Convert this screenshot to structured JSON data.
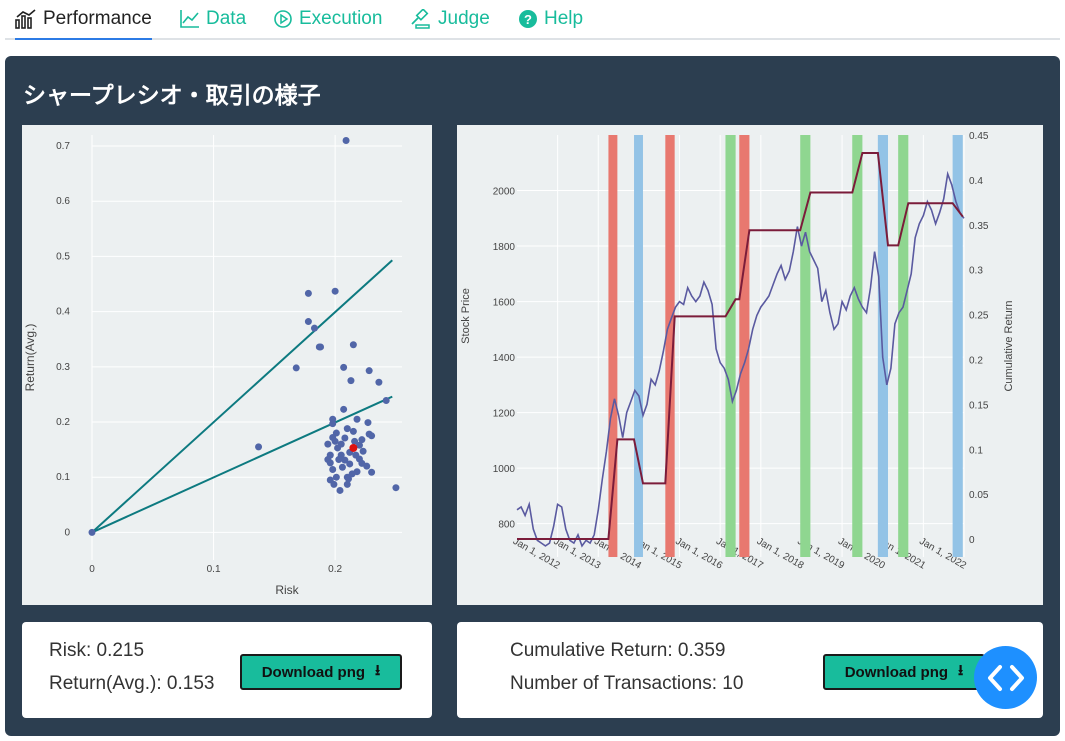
{
  "tabs": [
    {
      "label": "Performance",
      "icon": "chart-bar-icon"
    },
    {
      "label": "Data",
      "icon": "line-chart-icon"
    },
    {
      "label": "Execution",
      "icon": "play-circle-icon"
    },
    {
      "label": "Judge",
      "icon": "gavel-icon"
    },
    {
      "label": "Help",
      "icon": "question-circle-icon"
    }
  ],
  "panel": {
    "title": "シャープレシオ・取引の様子"
  },
  "left_card": {
    "risk_text": "Risk: 0.215",
    "return_text": "Return(Avg.): 0.153",
    "download_label": "Download png"
  },
  "right_card": {
    "cum_text": "Cumulative Return: 0.359",
    "ntx_text": "Number of Transactions: 10",
    "download_label": "Download png"
  },
  "colors": {
    "accent": "#18bc9c",
    "panel_bg": "#2c3e50",
    "plot_bg": "#ecf0f1",
    "scatter_point": "#5166a8",
    "highlight_point": "#dd1111",
    "line_teal": "#0d7a80",
    "cum_line": "#7b1c3a",
    "price_line": "#5a5aa0",
    "band_red": "#e8786f",
    "band_blue": "#93c3e6",
    "band_green": "#8fd690",
    "fab": "#1e90ff"
  },
  "chart_data": [
    {
      "type": "scatter",
      "xlabel": "Risk",
      "ylabel": "Return(Avg.)",
      "xlim": [
        0,
        0.255
      ],
      "ylim": [
        -0.05,
        0.72
      ],
      "xticks": [
        0,
        0.1,
        0.2
      ],
      "yticks": [
        0,
        0.1,
        0.2,
        0.3,
        0.4,
        0.5,
        0.6,
        0.7
      ],
      "x_tick_labels": [
        "0",
        "0.1",
        "0.2"
      ],
      "y_tick_labels": [
        "0",
        "0.1",
        "0.2",
        "0.3",
        "0.4",
        "0.5",
        "0.6",
        "0.7"
      ],
      "grid": true,
      "lines": [
        {
          "x": [
            0,
            0.247
          ],
          "y": [
            0,
            0.493
          ]
        },
        {
          "x": [
            0,
            0.247
          ],
          "y": [
            0,
            0.246
          ]
        }
      ],
      "highlight": {
        "x": 0.215,
        "y": 0.153
      },
      "points": [
        [
          0,
          0
        ],
        [
          0.137,
          0.155
        ],
        [
          0.168,
          0.298
        ],
        [
          0.178,
          0.433
        ],
        [
          0.178,
          0.382
        ],
        [
          0.183,
          0.37
        ],
        [
          0.187,
          0.336
        ],
        [
          0.188,
          0.336
        ],
        [
          0.2,
          0.437
        ],
        [
          0.207,
          0.299
        ],
        [
          0.209,
          0.71
        ],
        [
          0.215,
          0.34
        ],
        [
          0.213,
          0.275
        ],
        [
          0.207,
          0.223
        ],
        [
          0.198,
          0.205
        ],
        [
          0.198,
          0.197
        ],
        [
          0.218,
          0.205
        ],
        [
          0.228,
          0.293
        ],
        [
          0.236,
          0.272
        ],
        [
          0.242,
          0.239
        ],
        [
          0.25,
          0.081
        ],
        [
          0.227,
          0.199
        ],
        [
          0.228,
          0.178
        ],
        [
          0.23,
          0.175
        ],
        [
          0.226,
          0.12
        ],
        [
          0.23,
          0.109
        ],
        [
          0.21,
          0.188
        ],
        [
          0.215,
          0.183
        ],
        [
          0.222,
          0.168
        ],
        [
          0.194,
          0.16
        ],
        [
          0.196,
          0.14
        ],
        [
          0.2,
          0.165
        ],
        [
          0.202,
          0.153
        ],
        [
          0.205,
          0.14
        ],
        [
          0.208,
          0.131
        ],
        [
          0.212,
          0.124
        ],
        [
          0.196,
          0.126
        ],
        [
          0.198,
          0.114
        ],
        [
          0.201,
          0.1
        ],
        [
          0.199,
          0.087
        ],
        [
          0.196,
          0.095
        ],
        [
          0.204,
          0.076
        ],
        [
          0.21,
          0.1
        ],
        [
          0.214,
          0.106
        ],
        [
          0.217,
          0.14
        ],
        [
          0.22,
          0.133
        ],
        [
          0.223,
          0.147
        ],
        [
          0.21,
          0.087
        ],
        [
          0.205,
          0.16
        ],
        [
          0.216,
          0.165
        ],
        [
          0.218,
          0.11
        ],
        [
          0.201,
          0.18
        ],
        [
          0.208,
          0.171
        ],
        [
          0.194,
          0.132
        ],
        [
          0.222,
          0.125
        ],
        [
          0.212,
          0.145
        ],
        [
          0.206,
          0.118
        ],
        [
          0.22,
          0.158
        ],
        [
          0.198,
          0.172
        ],
        [
          0.211,
          0.097
        ],
        [
          0.203,
          0.132
        ]
      ]
    },
    {
      "type": "line",
      "ylabel": "Stock Price",
      "y2label": "Cumulative Return",
      "ylim": [
        680,
        2200
      ],
      "y2lim": [
        -0.02,
        0.45
      ],
      "yticks": [
        800,
        1000,
        1200,
        1400,
        1600,
        1800,
        2000
      ],
      "y2ticks": [
        0,
        0.05,
        0.1,
        0.15,
        0.2,
        0.25,
        0.3,
        0.35,
        0.4,
        0.45
      ],
      "y_tick_labels": [
        "800",
        "1000",
        "1200",
        "1400",
        "1600",
        "1800",
        "2000"
      ],
      "y2_tick_labels": [
        "0",
        "0.05",
        "0.1",
        "0.15",
        "0.2",
        "0.25",
        "0.3",
        "0.35",
        "0.4",
        "0.45"
      ],
      "xlim": [
        2011.0,
        2022.0
      ],
      "x_tick_values": [
        2012,
        2013,
        2014,
        2015,
        2016,
        2017,
        2018,
        2019,
        2020,
        2021,
        2022
      ],
      "x_tick_labels": [
        "Jan 1, 2012",
        "Jan 1, 2013",
        "Jan 1, 2014",
        "Jan 1, 2015",
        "Jan 1, 2016",
        "Jan 1, 2017",
        "Jan 1, 2018",
        "Jan 1, 2019",
        "Jan 1, 2020",
        "Jan 1, 2021",
        "Jan 1, 2022"
      ],
      "grid": true,
      "bands": [
        {
          "x0": 2013.25,
          "x1": 2013.47,
          "color": "red"
        },
        {
          "x0": 2013.88,
          "x1": 2014.1,
          "color": "blue"
        },
        {
          "x0": 2014.65,
          "x1": 2014.88,
          "color": "red"
        },
        {
          "x0": 2016.13,
          "x1": 2016.38,
          "color": "green"
        },
        {
          "x0": 2016.47,
          "x1": 2016.72,
          "color": "red"
        },
        {
          "x0": 2017.97,
          "x1": 2018.22,
          "color": "green"
        },
        {
          "x0": 2019.25,
          "x1": 2019.5,
          "color": "green"
        },
        {
          "x0": 2019.88,
          "x1": 2020.13,
          "color": "blue"
        },
        {
          "x0": 2020.38,
          "x1": 2020.63,
          "color": "green"
        },
        {
          "x0": 2021.72,
          "x1": 2021.97,
          "color": "blue"
        }
      ],
      "cumulative": [
        [
          2011.0,
          0
        ],
        [
          2013.25,
          0
        ],
        [
          2013.47,
          0.111
        ],
        [
          2013.88,
          0.111
        ],
        [
          2014.1,
          0.062
        ],
        [
          2014.65,
          0.062
        ],
        [
          2014.88,
          0.248
        ],
        [
          2016.13,
          0.248
        ],
        [
          2016.38,
          0.267
        ],
        [
          2016.47,
          0.267
        ],
        [
          2016.72,
          0.344
        ],
        [
          2017.97,
          0.344
        ],
        [
          2018.22,
          0.386
        ],
        [
          2019.25,
          0.386
        ],
        [
          2019.5,
          0.43
        ],
        [
          2019.88,
          0.43
        ],
        [
          2020.13,
          0.327
        ],
        [
          2020.38,
          0.327
        ],
        [
          2020.63,
          0.374
        ],
        [
          2021.72,
          0.374
        ],
        [
          2021.97,
          0.359
        ]
      ],
      "price": [
        [
          2011.0,
          850
        ],
        [
          2011.1,
          860
        ],
        [
          2011.2,
          830
        ],
        [
          2011.3,
          870
        ],
        [
          2011.4,
          780
        ],
        [
          2011.5,
          740
        ],
        [
          2011.6,
          730
        ],
        [
          2011.7,
          720
        ],
        [
          2011.8,
          730
        ],
        [
          2011.9,
          790
        ],
        [
          2012.0,
          870
        ],
        [
          2012.1,
          860
        ],
        [
          2012.2,
          780
        ],
        [
          2012.3,
          740
        ],
        [
          2012.4,
          730
        ],
        [
          2012.5,
          760
        ],
        [
          2012.6,
          720
        ],
        [
          2012.7,
          740
        ],
        [
          2012.8,
          730
        ],
        [
          2012.9,
          760
        ],
        [
          2013.0,
          850
        ],
        [
          2013.1,
          960
        ],
        [
          2013.2,
          1060
        ],
        [
          2013.3,
          1180
        ],
        [
          2013.4,
          1250
        ],
        [
          2013.5,
          1190
        ],
        [
          2013.6,
          1110
        ],
        [
          2013.7,
          1200
        ],
        [
          2013.8,
          1240
        ],
        [
          2013.9,
          1280
        ],
        [
          2014.0,
          1260
        ],
        [
          2014.1,
          1190
        ],
        [
          2014.2,
          1230
        ],
        [
          2014.3,
          1320
        ],
        [
          2014.4,
          1300
        ],
        [
          2014.5,
          1350
        ],
        [
          2014.6,
          1420
        ],
        [
          2014.7,
          1500
        ],
        [
          2014.8,
          1540
        ],
        [
          2014.9,
          1580
        ],
        [
          2015.0,
          1600
        ],
        [
          2015.1,
          1590
        ],
        [
          2015.2,
          1650
        ],
        [
          2015.3,
          1620
        ],
        [
          2015.4,
          1600
        ],
        [
          2015.5,
          1620
        ],
        [
          2015.6,
          1670
        ],
        [
          2015.7,
          1640
        ],
        [
          2015.8,
          1590
        ],
        [
          2015.9,
          1430
        ],
        [
          2016.0,
          1380
        ],
        [
          2016.1,
          1360
        ],
        [
          2016.2,
          1320
        ],
        [
          2016.3,
          1240
        ],
        [
          2016.4,
          1280
        ],
        [
          2016.5,
          1340
        ],
        [
          2016.6,
          1380
        ],
        [
          2016.7,
          1430
        ],
        [
          2016.8,
          1500
        ],
        [
          2016.9,
          1550
        ],
        [
          2017.0,
          1580
        ],
        [
          2017.1,
          1600
        ],
        [
          2017.2,
          1620
        ],
        [
          2017.3,
          1660
        ],
        [
          2017.4,
          1700
        ],
        [
          2017.5,
          1730
        ],
        [
          2017.6,
          1680
        ],
        [
          2017.7,
          1710
        ],
        [
          2017.8,
          1780
        ],
        [
          2017.9,
          1870
        ],
        [
          2018.0,
          1800
        ],
        [
          2018.1,
          1850
        ],
        [
          2018.2,
          1780
        ],
        [
          2018.3,
          1750
        ],
        [
          2018.4,
          1720
        ],
        [
          2018.5,
          1600
        ],
        [
          2018.6,
          1640
        ],
        [
          2018.7,
          1560
        ],
        [
          2018.8,
          1500
        ],
        [
          2018.9,
          1520
        ],
        [
          2019.0,
          1600
        ],
        [
          2019.1,
          1570
        ],
        [
          2019.2,
          1620
        ],
        [
          2019.3,
          1650
        ],
        [
          2019.4,
          1610
        ],
        [
          2019.5,
          1580
        ],
        [
          2019.6,
          1560
        ],
        [
          2019.7,
          1650
        ],
        [
          2019.8,
          1780
        ],
        [
          2019.9,
          1690
        ],
        [
          2020.0,
          1400
        ],
        [
          2020.1,
          1300
        ],
        [
          2020.2,
          1360
        ],
        [
          2020.3,
          1520
        ],
        [
          2020.4,
          1560
        ],
        [
          2020.5,
          1580
        ],
        [
          2020.6,
          1640
        ],
        [
          2020.7,
          1700
        ],
        [
          2020.8,
          1830
        ],
        [
          2020.9,
          1880
        ],
        [
          2021.0,
          1910
        ],
        [
          2021.1,
          1960
        ],
        [
          2021.2,
          1930
        ],
        [
          2021.3,
          1880
        ],
        [
          2021.4,
          1920
        ],
        [
          2021.5,
          1970
        ],
        [
          2021.6,
          2060
        ],
        [
          2021.7,
          2020
        ],
        [
          2021.8,
          1960
        ],
        [
          2021.9,
          1920
        ],
        [
          2022.0,
          1900
        ]
      ]
    }
  ]
}
